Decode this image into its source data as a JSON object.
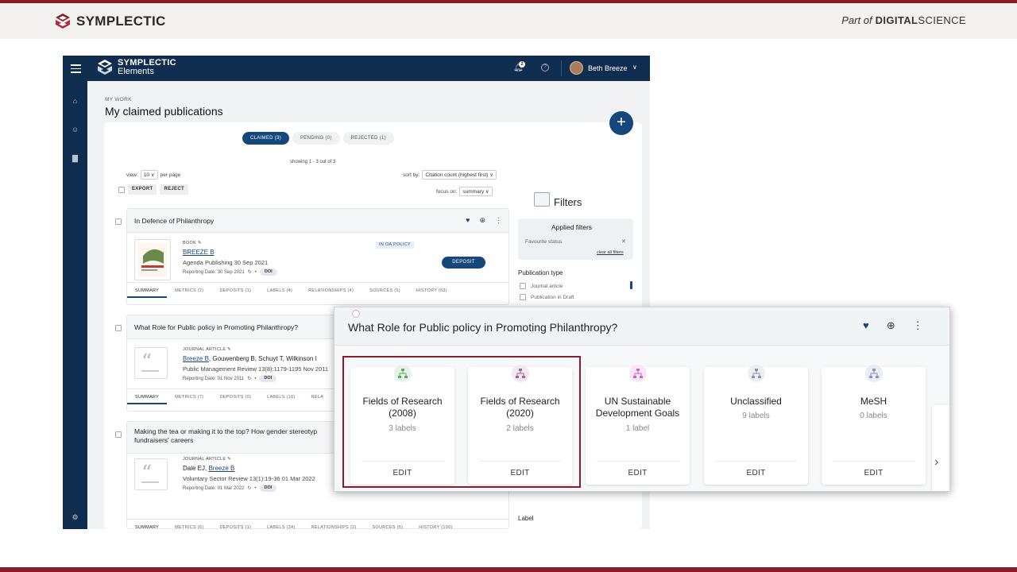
{
  "brand": {
    "name": "SYMPLECTIC",
    "partof_pre": "Part of",
    "partof_ds1": "DIGITAL",
    "partof_ds2": "SCIENCE",
    "accent": "#8a1b2a"
  },
  "app": {
    "logo_line1": "SYMPLECTIC",
    "logo_line2": "Elements",
    "notifications": "2",
    "user": "Beth Breeze",
    "navy": "#0f2d4e"
  },
  "page": {
    "crumb": "MY WORK",
    "title": "My claimed publications",
    "tabs": [
      {
        "label": "CLAIMED (3)"
      },
      {
        "label": "PENDING (0)"
      },
      {
        "label": "REJECTED (1)"
      }
    ],
    "showing": "showing 1 - 3 out of 3",
    "view_label": "view:",
    "view_value": "10",
    "per_page": "per page",
    "sort_label": "sort by:",
    "sort_value": "Citation count (highest first)",
    "focus_label": "focus on:",
    "focus_value": "summary",
    "export": "EXPORT",
    "reject": "REJECT"
  },
  "publications": [
    {
      "title": "In Defence of Philanthropy",
      "type": "BOOK",
      "authors_link": "BREEZE B",
      "authors_rest": "",
      "journal": "Agenda Publishing 30 Sep 2021",
      "reporting": "Reporting Date: 30 Sep 2021",
      "doi": "DOI",
      "oa": "IN OA POLICY",
      "deposit": "DEPOSIT",
      "tabs": [
        "SUMMARY",
        "METRICS (2)",
        "DEPOSITS (1)",
        "LABELS (4)",
        "RELATIONSHIPS (4)",
        "SOURCES (5)",
        "HISTORY (63)"
      ]
    },
    {
      "title": "What Role for Public policy in Promoting Philanthropy?",
      "type": "JOURNAL ARTICLE",
      "authors_link": "Breeze B",
      "authors_rest": ", Gouwenberg B, Schuyt T, Wilkinson I",
      "journal": "Public Management Review 13(8):1179-1195 Nov 2011",
      "reporting": "Reporting Date: 01 Nov 2011",
      "doi": "DOI",
      "tabs": [
        "SUMMARY",
        "METRICS (7)",
        "DEPOSITS (0)",
        "LABELS (16)",
        "RELA"
      ]
    },
    {
      "title_line1": "Making the tea or making it to the top? How gender stereotyp",
      "title_line2": "fundraisers' careers",
      "type": "JOURNAL ARTICLE",
      "authors_pre": "Dale EJ, ",
      "authors_link": "Breeze B",
      "journal": "Voluntary Sector Review 13(1):19-36 01 Mar 2022",
      "reporting": "Reporting Date: 01 Mar 2022",
      "doi": "DOI",
      "tabs": [
        "SUMMARY",
        "METRICS (6)",
        "DEPOSITS (1)",
        "LABELS (34)",
        "RELATIONSHIPS (2)",
        "SOURCES (5)",
        "HISTORY (100)"
      ]
    }
  ],
  "filters": {
    "title": "Filters",
    "applied_title": "Applied filters",
    "favourite": "Favourite status",
    "clear_all": "clear all filters",
    "pubtype": "Publication type",
    "options": [
      "Journal article",
      "Publication in Draft"
    ],
    "label_heading": "Label"
  },
  "overlay": {
    "title": "What Role for Public policy in Promoting Philanthropy?",
    "cards": [
      {
        "title_line1": "Fields of Research",
        "title_line2": "(2008)",
        "sub": "3 labels",
        "edit": "EDIT",
        "color": "#5aa86a",
        "bg": "#e7f3e9"
      },
      {
        "title_line1": "Fields of Research",
        "title_line2": "(2020)",
        "sub": "2 labels",
        "edit": "EDIT",
        "color": "#9a6a92",
        "bg": "#f2e8f0"
      },
      {
        "title_line1": "UN Sustainable",
        "title_line2": "Development Goals",
        "sub": "1 label",
        "edit": "EDIT",
        "color": "#c86ab8",
        "bg": "#f8e6f4"
      },
      {
        "title_line1": "Unclassified",
        "title_line2": "",
        "sub": "9 labels",
        "edit": "EDIT",
        "color": "#8a96a6",
        "bg": "#eceef1"
      },
      {
        "title_line1": "MeSH",
        "title_line2": "",
        "sub": "0 labels",
        "edit": "EDIT",
        "color": "#8a96b6",
        "bg": "#e9ecf3"
      }
    ]
  }
}
